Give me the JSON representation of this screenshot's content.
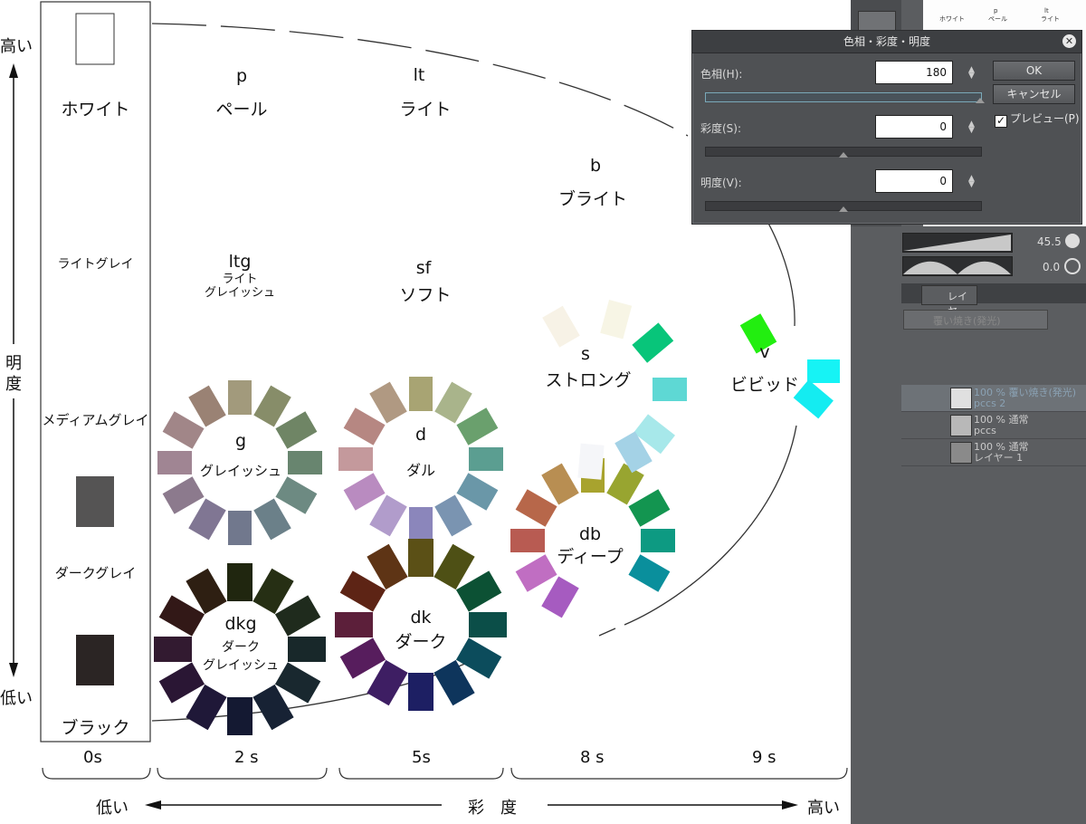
{
  "axes": {
    "brightness_high": "高い",
    "brightness_low": "低い",
    "brightness_label": [
      "明",
      "度"
    ],
    "saturation_low": "低い",
    "saturation_high": "高い",
    "saturation_label": "彩　度",
    "saturation_ticks": [
      "0s",
      "2 s",
      "5s",
      "8 s",
      "9 s"
    ]
  },
  "achromatic": {
    "white": "ホワイト",
    "light_gray": "ライトグレイ",
    "medium_gray": "メディアムグレイ",
    "dark_gray": "ダークグレイ",
    "black": "ブラック",
    "white_color": "#ffffff",
    "dark_gray_color": "#555454",
    "black_color": "#2b2524"
  },
  "tones": {
    "p": {
      "code": "p",
      "name": "ペール"
    },
    "lt": {
      "code": "lt",
      "name": "ライト"
    },
    "b": {
      "code": "b",
      "name": "ブライト"
    },
    "ltg": {
      "code": "ltg",
      "name_line1": "ライト",
      "name_line2": "グレイッシュ"
    },
    "sf": {
      "code": "sf",
      "name": "ソフト"
    },
    "s": {
      "code": "s",
      "name": "ストロング"
    },
    "v": {
      "code": "v",
      "name": "ビビッド"
    },
    "g": {
      "code": "g",
      "name": "グレイッシュ"
    },
    "d": {
      "code": "d",
      "name": "ダル"
    },
    "db": {
      "code": "db",
      "name": "ディープ"
    },
    "dkg": {
      "code": "dkg",
      "name_line1": "ダーク",
      "name_line2": "グレイッシュ"
    },
    "dk": {
      "code": "dk",
      "name": "ダーク"
    }
  },
  "wheels": {
    "g": [
      "#a29a7c",
      "#878d69",
      "#6f8565",
      "#68856f",
      "#6d8a82",
      "#6b8089",
      "#71788d",
      "#807693",
      "#8c7a8d",
      "#a08593",
      "#a18688",
      "#9a8274"
    ],
    "d": [
      "#a8a473",
      "#a9b48b",
      "#6aa06d",
      "#5b9e91",
      "#6a97a8",
      "#7a94b1",
      "#8b86bb",
      "#b19ccb",
      "#b98bc0",
      "#c4999c",
      "#b68782",
      "#b09982"
    ],
    "dkg": [
      "#20260f",
      "#262f14",
      "#1f2b1d",
      "#18282a",
      "#19282f",
      "#172234",
      "#141932",
      "#1f1838",
      "#2a1634",
      "#321a30",
      "#321817",
      "#2e1f12"
    ],
    "dk": [
      "#5b5016",
      "#4e5015",
      "#0c5134",
      "#0b4e48",
      "#0c4c5c",
      "#0e355c",
      "#1d1f63",
      "#3e1e63",
      "#571d5d",
      "#5c1f3a",
      "#5d2415",
      "#5e3415"
    ],
    "db": [
      "#a8a32e",
      "#98a530",
      "#139550",
      "#0d9a82",
      "#0a8f9c",
      "#a65bc0",
      "#c06ec2",
      "#b85b52",
      "#b7674a",
      "#b88e52"
    ],
    "s": [
      "#f7f2e6",
      "#f7f5e5",
      "#08c57a",
      "#5ed8d4",
      "#a7e8ea",
      "#a4d2e6",
      "#f5f6f9"
    ],
    "v": [
      "#22ee10",
      "#16f3f5",
      "#14ecf1"
    ]
  },
  "dialog": {
    "title": "色相・彩度・明度",
    "hue_label": "色相(H):",
    "hue_value": "180",
    "saturation_label": "彩度(S):",
    "saturation_value": "0",
    "value_label": "明度(V):",
    "value_value": "0",
    "ok": "OK",
    "cancel": "キャンセル",
    "preview": "プレビュー(P)",
    "preview_checked": "✓",
    "close": "✕"
  },
  "panel": {
    "dial1_value": "45.5",
    "dial2_value": "0.0",
    "layer_tab": "レイヤー",
    "blend_mode": "覆い焼き(発光)",
    "layers": [
      {
        "line1": "100 % 覆い焼き(発光)",
        "line2": "pccs 2"
      },
      {
        "line1": "100 % 通常",
        "line2": "pccs"
      },
      {
        "line1": "100 % 通常",
        "line2": "レイヤー 1"
      }
    ],
    "thumb_labels": [
      "ホワイト",
      "p",
      "ペール",
      "lt",
      "ライト"
    ]
  }
}
